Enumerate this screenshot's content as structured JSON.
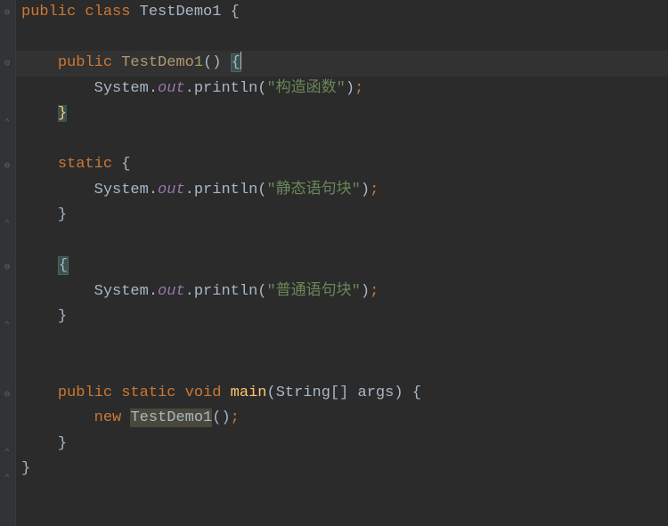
{
  "code": {
    "l1": {
      "kw1": "public",
      "kw2": "class",
      "cls": "TestDemo1",
      "brace": "{"
    },
    "l3": {
      "kw1": "public",
      "ctor": "TestDemo1",
      "par": "()",
      "brace_open": "{"
    },
    "l4": {
      "cls": "System",
      "dot1": ".",
      "out": "out",
      "dot2": ".",
      "mtd": "println",
      "open": "(",
      "str": "\"构造函数\"",
      "close": ")",
      "semi": ";"
    },
    "l5": {
      "brace_close": "}"
    },
    "l7": {
      "kw": "static",
      "brace": "{"
    },
    "l8": {
      "cls": "System",
      "dot1": ".",
      "out": "out",
      "dot2": ".",
      "mtd": "println",
      "open": "(",
      "str": "\"静态语句块\"",
      "close": ")",
      "semi": ";"
    },
    "l9": {
      "brace": "}"
    },
    "l11": {
      "brace": "{"
    },
    "l12": {
      "cls": "System",
      "dot1": ".",
      "out": "out",
      "dot2": ".",
      "mtd": "println",
      "open": "(",
      "str": "\"普通语句块\"",
      "close": ")",
      "semi": ";"
    },
    "l13": {
      "brace": "}"
    },
    "l15": {
      "kw1": "public",
      "kw2": "static",
      "kw3": "void",
      "mtd": "main",
      "open": "(",
      "type": "String[]",
      "arg": "args",
      "close": ")",
      "brace": "{"
    },
    "l16": {
      "kw": "new",
      "cls": "TestDemo1",
      "par": "()",
      "semi": ";"
    },
    "l17": {
      "brace": "}"
    },
    "l18": {
      "brace": "}"
    }
  }
}
